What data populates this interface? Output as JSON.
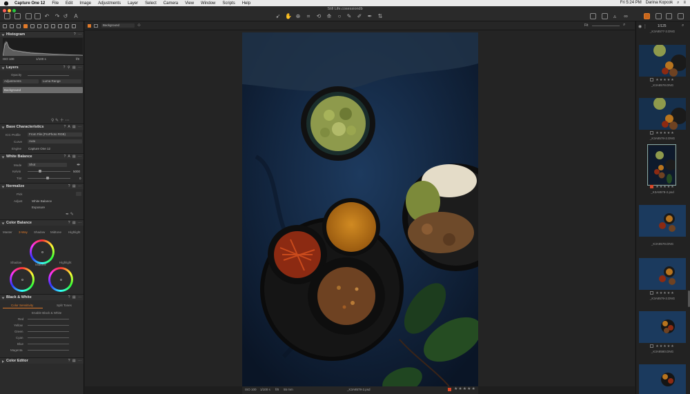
{
  "menubar": {
    "app_name": "Capture One 12",
    "items": [
      "File",
      "Edit",
      "Image",
      "Adjustments",
      "Layer",
      "Select",
      "Camera",
      "View",
      "Window",
      "Scripts",
      "Help"
    ],
    "clock": "Fri 5:24 PM",
    "user": "Darina Kopcok"
  },
  "window": {
    "title": "Still Life.cosessiondb"
  },
  "left": {
    "histogram": {
      "title": "Histogram",
      "iso": "ISO 100",
      "shutter": "1/100 s",
      "aperture": "f/8"
    },
    "layers": {
      "title": "Layers",
      "opacity_label": "Opacity",
      "adjustments_label": "Adjustments",
      "luma_label": "Luma Range",
      "layer_name": "Background"
    },
    "base": {
      "title": "Base Characteristics",
      "icc_label": "ICC Profile",
      "icc_value": "From File (ProPhoto RGB)",
      "curve_label": "Curve",
      "curve_value": "Auto",
      "engine_label": "Engine",
      "engine_value": "Capture One 12"
    },
    "wb": {
      "title": "White Balance",
      "mode_label": "Mode",
      "mode_value": "Shot",
      "kelvin_label": "Kelvin",
      "kelvin_value": "5000",
      "tint_label": "Tint",
      "tint_value": "0"
    },
    "normalize": {
      "title": "Normalize",
      "pick_label": "Pick",
      "adjust_label": "Adjust",
      "wb_label": "White Balance",
      "exposure_label": "Exposure"
    },
    "color_balance": {
      "title": "Color Balance",
      "tabs": [
        "Master",
        "3-Way",
        "Shadow",
        "Midtone",
        "Highlight"
      ],
      "shadow": "Shadow",
      "midtone": "Midtone",
      "highlight": "Highlight"
    },
    "bw": {
      "title": "Black & White",
      "tab1": "Color Sensitivity",
      "tab2": "Split Tones",
      "enable": "Enable Black & White",
      "rows": [
        "Red",
        "Yellow",
        "Green",
        "Cyan",
        "Blue",
        "Magenta"
      ]
    },
    "color_editor": {
      "title": "Color Editor"
    }
  },
  "viewer": {
    "layer_select": "Background",
    "fit_label": "Fit",
    "footer": {
      "iso": "ISO 100",
      "shutter": "1/100 s",
      "aperture": "f/8",
      "focal": "55 mm",
      "filename": "_K3A8578-2.psd"
    },
    "stars": "★★★★★"
  },
  "browser": {
    "counter": "1/125",
    "thumbs": [
      {
        "name": "_K3A8577-2.DNG"
      },
      {
        "name": "_K3A8578.DNG"
      },
      {
        "name": "_K3A8578-2.DNG"
      },
      {
        "name": "_K3A8578-2.psd"
      },
      {
        "name": "_K3A8578.DNG"
      },
      {
        "name": "_K3A8579-2.DNG"
      },
      {
        "name": "_K3A8580.DNG"
      },
      {
        "name": ""
      }
    ],
    "stars": "★★★★★"
  },
  "colors": {
    "accent": "#e07a2a",
    "label_red": "#d9482a",
    "photo_bg": "#0e1a2c"
  }
}
